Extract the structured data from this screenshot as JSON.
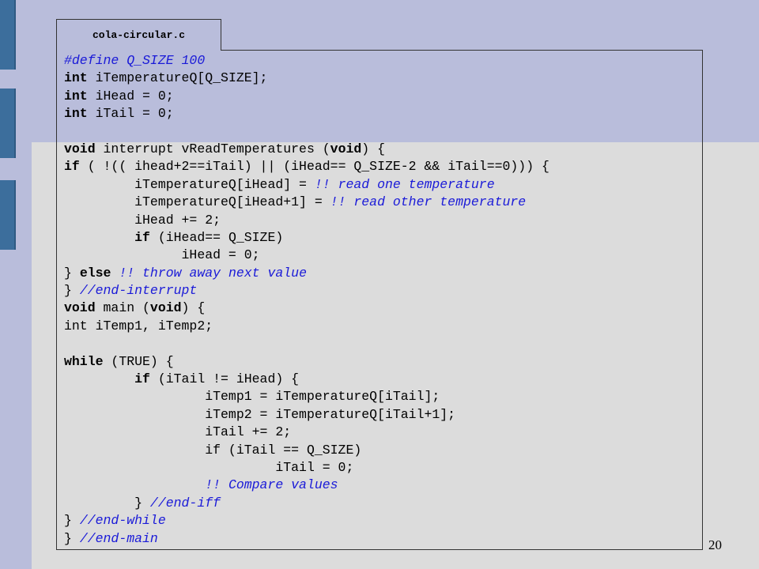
{
  "file_tab": {
    "label": "cola-circular.c"
  },
  "page_number": "20",
  "code_lines": [
    [
      {
        "t": "#define Q_SIZE 100",
        "s": "cm"
      }
    ],
    [
      {
        "t": "int",
        "s": "kw"
      },
      {
        "t": " iTemperatureQ[Q_SIZE];"
      }
    ],
    [
      {
        "t": "int",
        "s": "kw"
      },
      {
        "t": " iHead = 0;"
      }
    ],
    [
      {
        "t": "int",
        "s": "kw"
      },
      {
        "t": " iTail = 0;"
      }
    ],
    [],
    [
      {
        "t": "void",
        "s": "kw"
      },
      {
        "t": " interrupt vReadTemperatures ("
      },
      {
        "t": "void",
        "s": "kw"
      },
      {
        "t": ") {"
      }
    ],
    [
      {
        "t": "if",
        "s": "kw"
      },
      {
        "t": " ( !(( ihead+2==iTail) || (iHead== Q_SIZE-2 && iTail==0))) {"
      }
    ],
    [
      {
        "t": "         iTemperatureQ[iHead] = "
      },
      {
        "t": "!! read one temperature",
        "s": "cm"
      }
    ],
    [
      {
        "t": "         iTemperatureQ[iHead+1] = "
      },
      {
        "t": "!! read other temperature",
        "s": "cm"
      }
    ],
    [
      {
        "t": "         iHead += 2;"
      }
    ],
    [
      {
        "t": "         "
      },
      {
        "t": "if",
        "s": "kw"
      },
      {
        "t": " (iHead== Q_SIZE)"
      }
    ],
    [
      {
        "t": "               iHead = 0;"
      }
    ],
    [
      {
        "t": "} "
      },
      {
        "t": "else",
        "s": "kw"
      },
      {
        "t": " "
      },
      {
        "t": "!! throw away next value",
        "s": "cm"
      }
    ],
    [
      {
        "t": "} "
      },
      {
        "t": "//end-interrupt",
        "s": "cm"
      }
    ],
    [
      {
        "t": "void",
        "s": "kw"
      },
      {
        "t": " main ("
      },
      {
        "t": "void",
        "s": "kw"
      },
      {
        "t": ") {"
      }
    ],
    [
      {
        "t": "int iTemp1, iTemp2;"
      }
    ],
    [],
    [
      {
        "t": "while",
        "s": "kw"
      },
      {
        "t": " (TRUE) {"
      }
    ],
    [
      {
        "t": "         "
      },
      {
        "t": "if",
        "s": "kw"
      },
      {
        "t": " (iTail != iHead) {"
      }
    ],
    [
      {
        "t": "                  iTemp1 = iTemperatureQ[iTail];"
      }
    ],
    [
      {
        "t": "                  iTemp2 = iTemperatureQ[iTail+1];"
      }
    ],
    [
      {
        "t": "                  iTail += 2;"
      }
    ],
    [
      {
        "t": "                  if (iTail == Q_SIZE)"
      }
    ],
    [
      {
        "t": "                           iTail = 0;"
      }
    ],
    [
      {
        "t": "                  "
      },
      {
        "t": "!! Compare values",
        "s": "cm"
      }
    ],
    [
      {
        "t": "         } "
      },
      {
        "t": "//end-iff",
        "s": "cm"
      }
    ],
    [
      {
        "t": "} "
      },
      {
        "t": "//end-while",
        "s": "cm"
      }
    ],
    [
      {
        "t": "} "
      },
      {
        "t": "//end-main",
        "s": "cm"
      }
    ]
  ],
  "colors": {
    "band": "#b9bddb",
    "panel": "#dcdcdc",
    "accent_bar": "#3c6e9c",
    "comment": "#1a1ad8"
  }
}
